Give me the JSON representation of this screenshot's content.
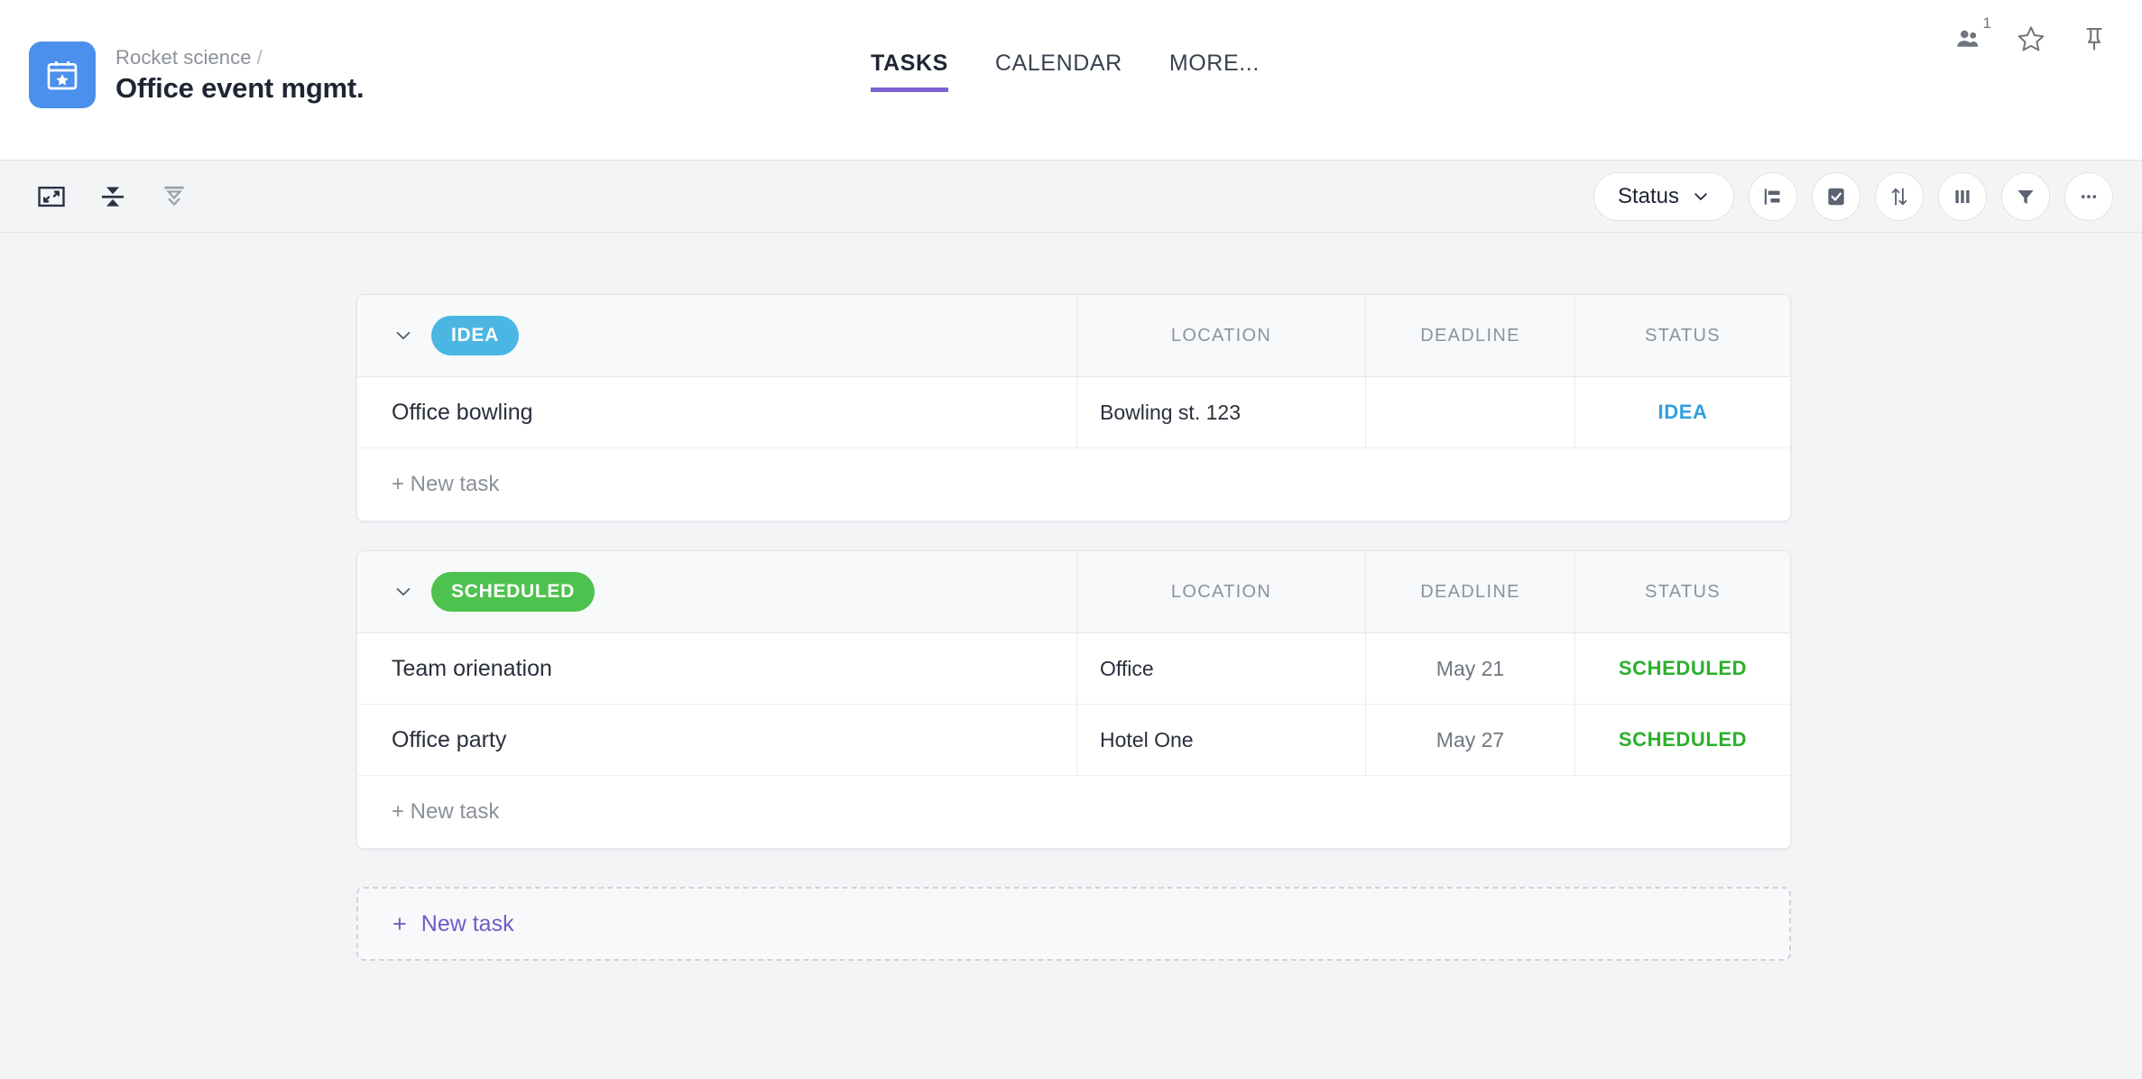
{
  "header": {
    "logo_icon": "calendar-star-icon",
    "breadcrumb_parent": "Rocket science",
    "breadcrumb_separator": "/",
    "project_title": "Office event mgmt.",
    "tabs": [
      {
        "label": "TASKS",
        "active": true
      },
      {
        "label": "CALENDAR",
        "active": false
      },
      {
        "label": "MORE...",
        "active": false
      }
    ],
    "actions": [
      {
        "icon": "members-icon",
        "badge": "1"
      },
      {
        "icon": "star-outline-icon",
        "badge": ""
      },
      {
        "icon": "pin-icon",
        "badge": ""
      }
    ],
    "accent_color": "#7b62d4",
    "logo_color": "#4a90ec"
  },
  "toolbar": {
    "left_icons": [
      {
        "icon": "fit-screen-icon"
      },
      {
        "icon": "collapse-all-icon"
      },
      {
        "icon": "expand-all-icon"
      }
    ],
    "group_by_label": "Status",
    "group_by_caret": "chevron-down-icon",
    "right_icons": [
      {
        "icon": "subtasks-icon"
      },
      {
        "icon": "checkbox-checked-icon"
      },
      {
        "icon": "sort-icon"
      },
      {
        "icon": "columns-icon"
      },
      {
        "icon": "filter-icon"
      },
      {
        "icon": "more-options-icon"
      }
    ]
  },
  "columns": {
    "name": "",
    "location": "LOCATION",
    "deadline": "DEADLINE",
    "status": "STATUS"
  },
  "groups": [
    {
      "id": "idea",
      "badge_label": "IDEA",
      "badge_color": "#4bb6e3",
      "status_text_color": "#2f9fe0",
      "collapse_icon": "chevron-down-icon",
      "tasks": [
        {
          "name": "Office bowling",
          "location": "Bowling st. 123",
          "deadline": "",
          "status": "IDEA"
        }
      ],
      "new_task_label": "+ New task"
    },
    {
      "id": "scheduled",
      "badge_label": "SCHEDULED",
      "badge_color": "#4ec24e",
      "status_text_color": "#2bb02b",
      "collapse_icon": "chevron-down-icon",
      "tasks": [
        {
          "name": "Team orienation",
          "location": "Office",
          "deadline": "May 21",
          "status": "SCHEDULED"
        },
        {
          "name": "Office party",
          "location": "Hotel One",
          "deadline": "May 27",
          "status": "SCHEDULED"
        }
      ],
      "new_task_label": "+ New task"
    }
  ],
  "footer_new_task": {
    "plus": "+",
    "label": "New task",
    "color": "#6b5ec7"
  }
}
